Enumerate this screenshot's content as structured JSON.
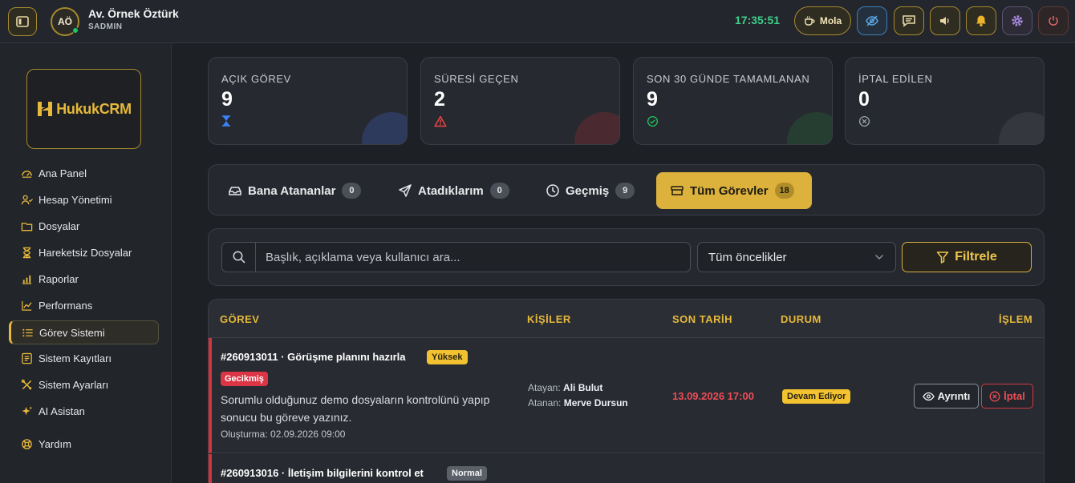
{
  "header": {
    "user_initials": "AÖ",
    "user_name": "Av. Örnek Öztürk",
    "user_role": "SADMIN",
    "clock": "17:35:51",
    "break_label": "Mola"
  },
  "sidebar": {
    "logo_text": "HukukCRM",
    "items": [
      {
        "label": "Ana Panel",
        "icon": "dashboard-icon"
      },
      {
        "label": "Hesap Yönetimi",
        "icon": "users-icon"
      },
      {
        "label": "Dosyalar",
        "icon": "folder-icon"
      },
      {
        "label": "Hareketsiz Dosyalar",
        "icon": "hourglass-icon"
      },
      {
        "label": "Raporlar",
        "icon": "bar-chart-icon"
      },
      {
        "label": "Performans",
        "icon": "line-chart-icon"
      },
      {
        "label": "Görev Sistemi",
        "icon": "list-icon",
        "active": true
      },
      {
        "label": "Sistem Kayıtları",
        "icon": "log-icon"
      },
      {
        "label": "Sistem Ayarları",
        "icon": "tools-icon"
      },
      {
        "label": "AI Asistan",
        "icon": "sparkle-icon"
      },
      {
        "label": "Yardım",
        "icon": "lifebuoy-icon"
      }
    ]
  },
  "stats": [
    {
      "label": "AÇIK GÖREV",
      "value": "9",
      "icon": "hourglass-icon",
      "color": "#3b82f6"
    },
    {
      "label": "SÜRESİ GEÇEN",
      "value": "2",
      "icon": "warning-icon",
      "color": "#ef4444"
    },
    {
      "label": "SON 30 GÜNDE TAMAMLANAN",
      "value": "9",
      "icon": "check-circle-icon",
      "color": "#22c55e"
    },
    {
      "label": "İPTAL EDİLEN",
      "value": "0",
      "icon": "x-circle-icon",
      "color": "#9ca3af"
    }
  ],
  "tabs": [
    {
      "label": "Bana Atananlar",
      "count": "0",
      "icon": "inbox-icon"
    },
    {
      "label": "Atadıklarım",
      "count": "0",
      "icon": "send-icon"
    },
    {
      "label": "Geçmiş",
      "count": "9",
      "icon": "clock-icon"
    },
    {
      "label": "Tüm Görevler",
      "count": "18",
      "icon": "archive-icon",
      "active": true
    }
  ],
  "filters": {
    "search_placeholder": "Başlık, açıklama veya kullanıcı ara...",
    "priority_selected": "Tüm öncelikler",
    "filter_label": "Filtrele"
  },
  "table": {
    "columns": [
      "GÖREV",
      "KİŞİLER",
      "SON TARİH",
      "DURUM",
      "İŞLEM"
    ],
    "rows": [
      {
        "title": "#260913011 · Görüşme planını hazırla",
        "priority": "Yüksek",
        "late_badge": "Gecikmiş",
        "description": "Sorumlu olduğunuz demo dosyaların kontrolünü yapıp sonucu bu göreve yazınız.",
        "created": "Oluşturma: 02.09.2026 09:00",
        "assigner_label": "Atayan:",
        "assigner": "Ali Bulut",
        "assignee_label": "Atanan:",
        "assignee": "Merve Dursun",
        "due": "13.09.2026 17:00",
        "status": "Devam Ediyor",
        "detail_label": "Ayrıntı",
        "cancel_label": "İptal"
      },
      {
        "title": "#260913016 · İletişim bilgilerini kontrol et",
        "priority": "Normal"
      }
    ]
  },
  "colors": {
    "accent": "#e7b93a",
    "danger": "#ef4c56",
    "success": "#3fd08b"
  }
}
